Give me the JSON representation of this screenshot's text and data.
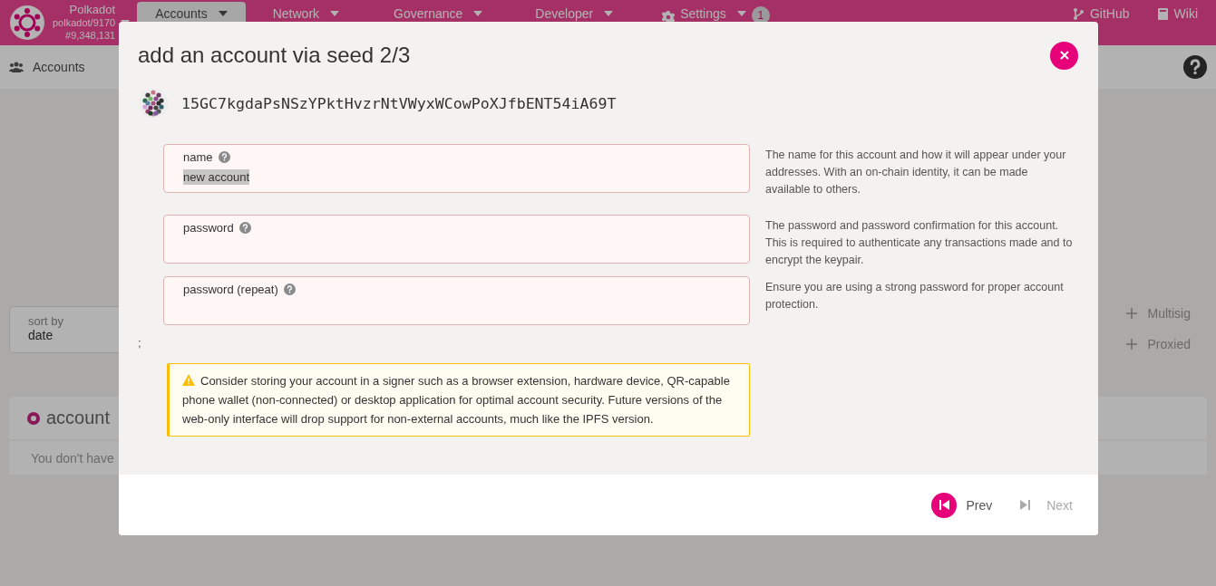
{
  "topbar": {
    "chain_name": "Polkadot",
    "chain_spec": "polkadot/9170",
    "block": "#9,348,131",
    "tabs": [
      {
        "label": "Accounts",
        "selected": true
      },
      {
        "label": "Network",
        "selected": false
      },
      {
        "label": "Governance",
        "selected": false
      },
      {
        "label": "Developer",
        "selected": false
      },
      {
        "label": "Settings",
        "selected": false,
        "badge": "1"
      }
    ],
    "links": [
      "GitHub",
      "Wiki"
    ]
  },
  "subbar": {
    "label": "Accounts"
  },
  "sort": {
    "label": "sort by",
    "value": "date"
  },
  "actions": [
    "Multisig",
    "Proxied"
  ],
  "accounts_card": {
    "title": "account",
    "empty_text": "You don't have"
  },
  "modal": {
    "title": "add an account via seed 2/3",
    "address": "15GC7kgdaPsNSzYPktHvzrNtVWyxWCowPoXJfbENT54iA69T",
    "fields": [
      {
        "label": "name",
        "value": "new account",
        "help": "The name for this account and how it will appear under your addresses. With an on-chain identity, it can be made available to others."
      },
      {
        "label": "password",
        "help": "The password and password confirmation for this account. This is required to authenticate any transactions made and to encrypt the keypair."
      },
      {
        "label": "password (repeat)",
        "help": "Ensure you are using a strong password for proper account protection."
      }
    ],
    "stray_text": ";",
    "warning": "Consider storing your account in a signer such as a browser extension, hardware device, QR-capable phone wallet (non-connected) or desktop application for optimal account security. Future versions of the web-only interface will drop support for non-external accounts, much like the IPFS version.",
    "buttons": [
      {
        "label": "Prev",
        "disabled": false
      },
      {
        "label": "Next",
        "disabled": true
      }
    ]
  }
}
